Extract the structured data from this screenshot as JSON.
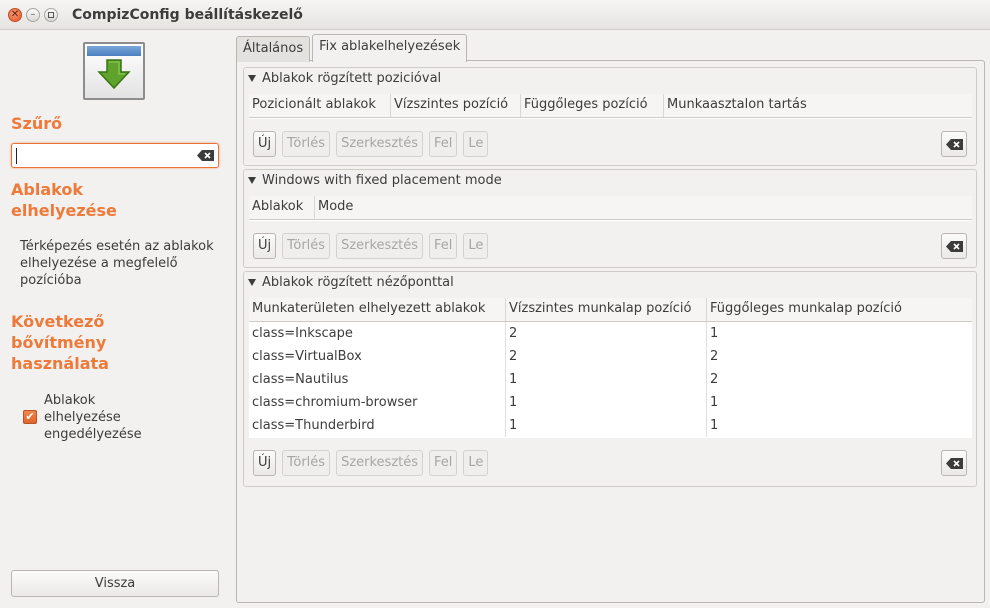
{
  "window": {
    "title": "CompizConfig beállításkezelő"
  },
  "sidebar": {
    "filter_title": "Szűrő",
    "filter_value": "",
    "section_title": "Ablakok elhelyezése",
    "description": "Térképezés esetén az ablakok elhelyezése a megfelelő pozícióba",
    "next_plugin_title": "Következő bővítmény használata",
    "enable_label": "Ablakok elhelyezése engedélyezése",
    "enable_checked": true,
    "back_label": "Vissza"
  },
  "tabs": [
    {
      "label": "Általános",
      "active": false
    },
    {
      "label": "Fix ablakelhelyezések",
      "active": true
    }
  ],
  "frames": [
    {
      "title": "Ablakok rögzített pozicióval",
      "columns": [
        "Pozicionált ablakok",
        "Vízszintes pozíció",
        "Függőleges pozíció",
        "Munkaasztalon tartás"
      ],
      "rows": []
    },
    {
      "title": "Windows with fixed placement mode",
      "columns": [
        "Ablakok",
        "Mode"
      ],
      "rows": []
    },
    {
      "title": "Ablakok rögzített nézőponttal",
      "columns": [
        "Munkaterületen elhelyezett ablakok",
        "Vízszintes munkalap pozíció",
        "Függőleges munkalap pozíció"
      ],
      "rows": [
        [
          "class=Inkscape",
          "2",
          "1"
        ],
        [
          "class=VirtualBox",
          "2",
          "2"
        ],
        [
          "class=Nautilus",
          "1",
          "2"
        ],
        [
          "class=chromium-browser",
          "1",
          "1"
        ],
        [
          "class=Thunderbird",
          "1",
          "1"
        ]
      ]
    }
  ],
  "buttons": {
    "new": "Új",
    "delete": "Törlés",
    "edit": "Szerkesztés",
    "up": "Fel",
    "down": "Le"
  }
}
